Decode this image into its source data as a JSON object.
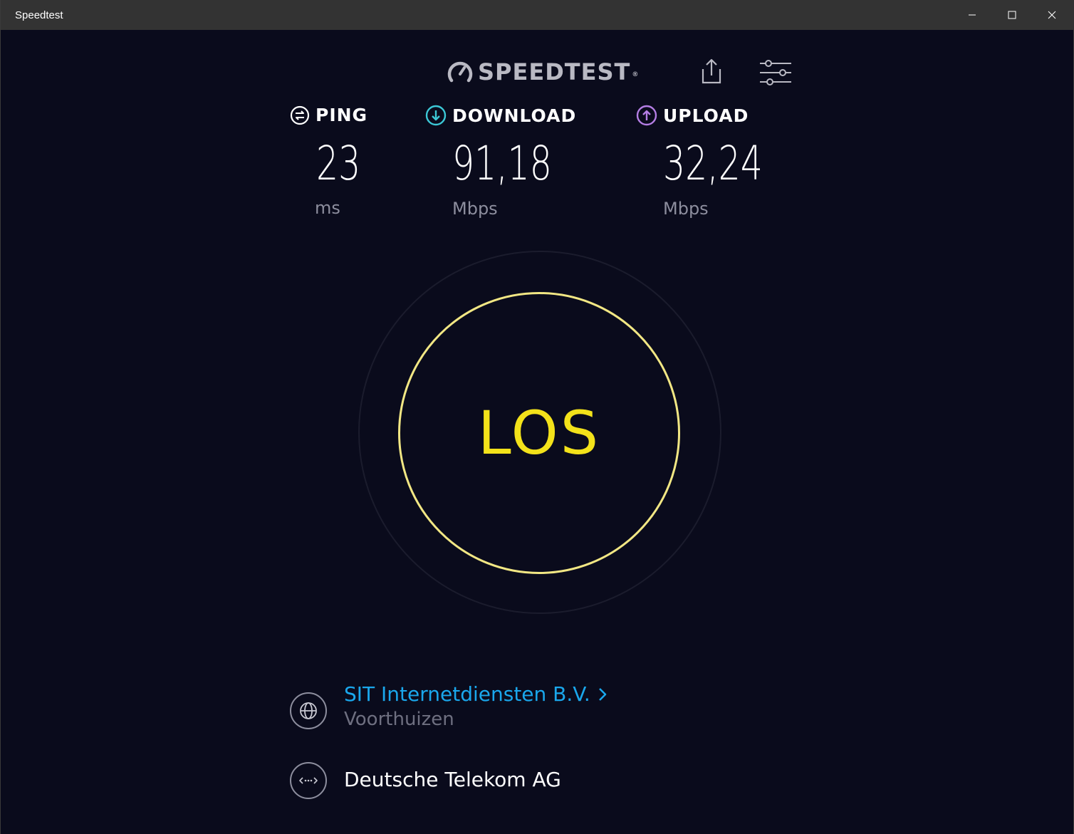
{
  "window": {
    "title": "Speedtest"
  },
  "header": {
    "logo_text": "SPEEDTEST",
    "logo_tm": "®",
    "share_icon": "share-icon",
    "settings_icon": "settings-sliders-icon"
  },
  "metrics": {
    "ping": {
      "label": "PING",
      "value": "23",
      "unit": "ms"
    },
    "download": {
      "label": "DOWNLOAD",
      "value": "91,18",
      "unit": "Mbps"
    },
    "upload": {
      "label": "UPLOAD",
      "value": "32,24",
      "unit": "Mbps"
    }
  },
  "go_button": {
    "label": "LOS"
  },
  "server": {
    "name": "SIT Internetdiensten B.V.",
    "location": "Voorthuizen"
  },
  "isp": {
    "name": "Deutsche Telekom AG"
  },
  "colors": {
    "background": "#0a0b1c",
    "go_text": "#f3e21a",
    "go_ring": "#f2e784",
    "download_accent": "#3cc8d6",
    "upload_accent": "#b47ee4",
    "server_link": "#1aa7ec",
    "muted_text": "#8d8e9e"
  }
}
